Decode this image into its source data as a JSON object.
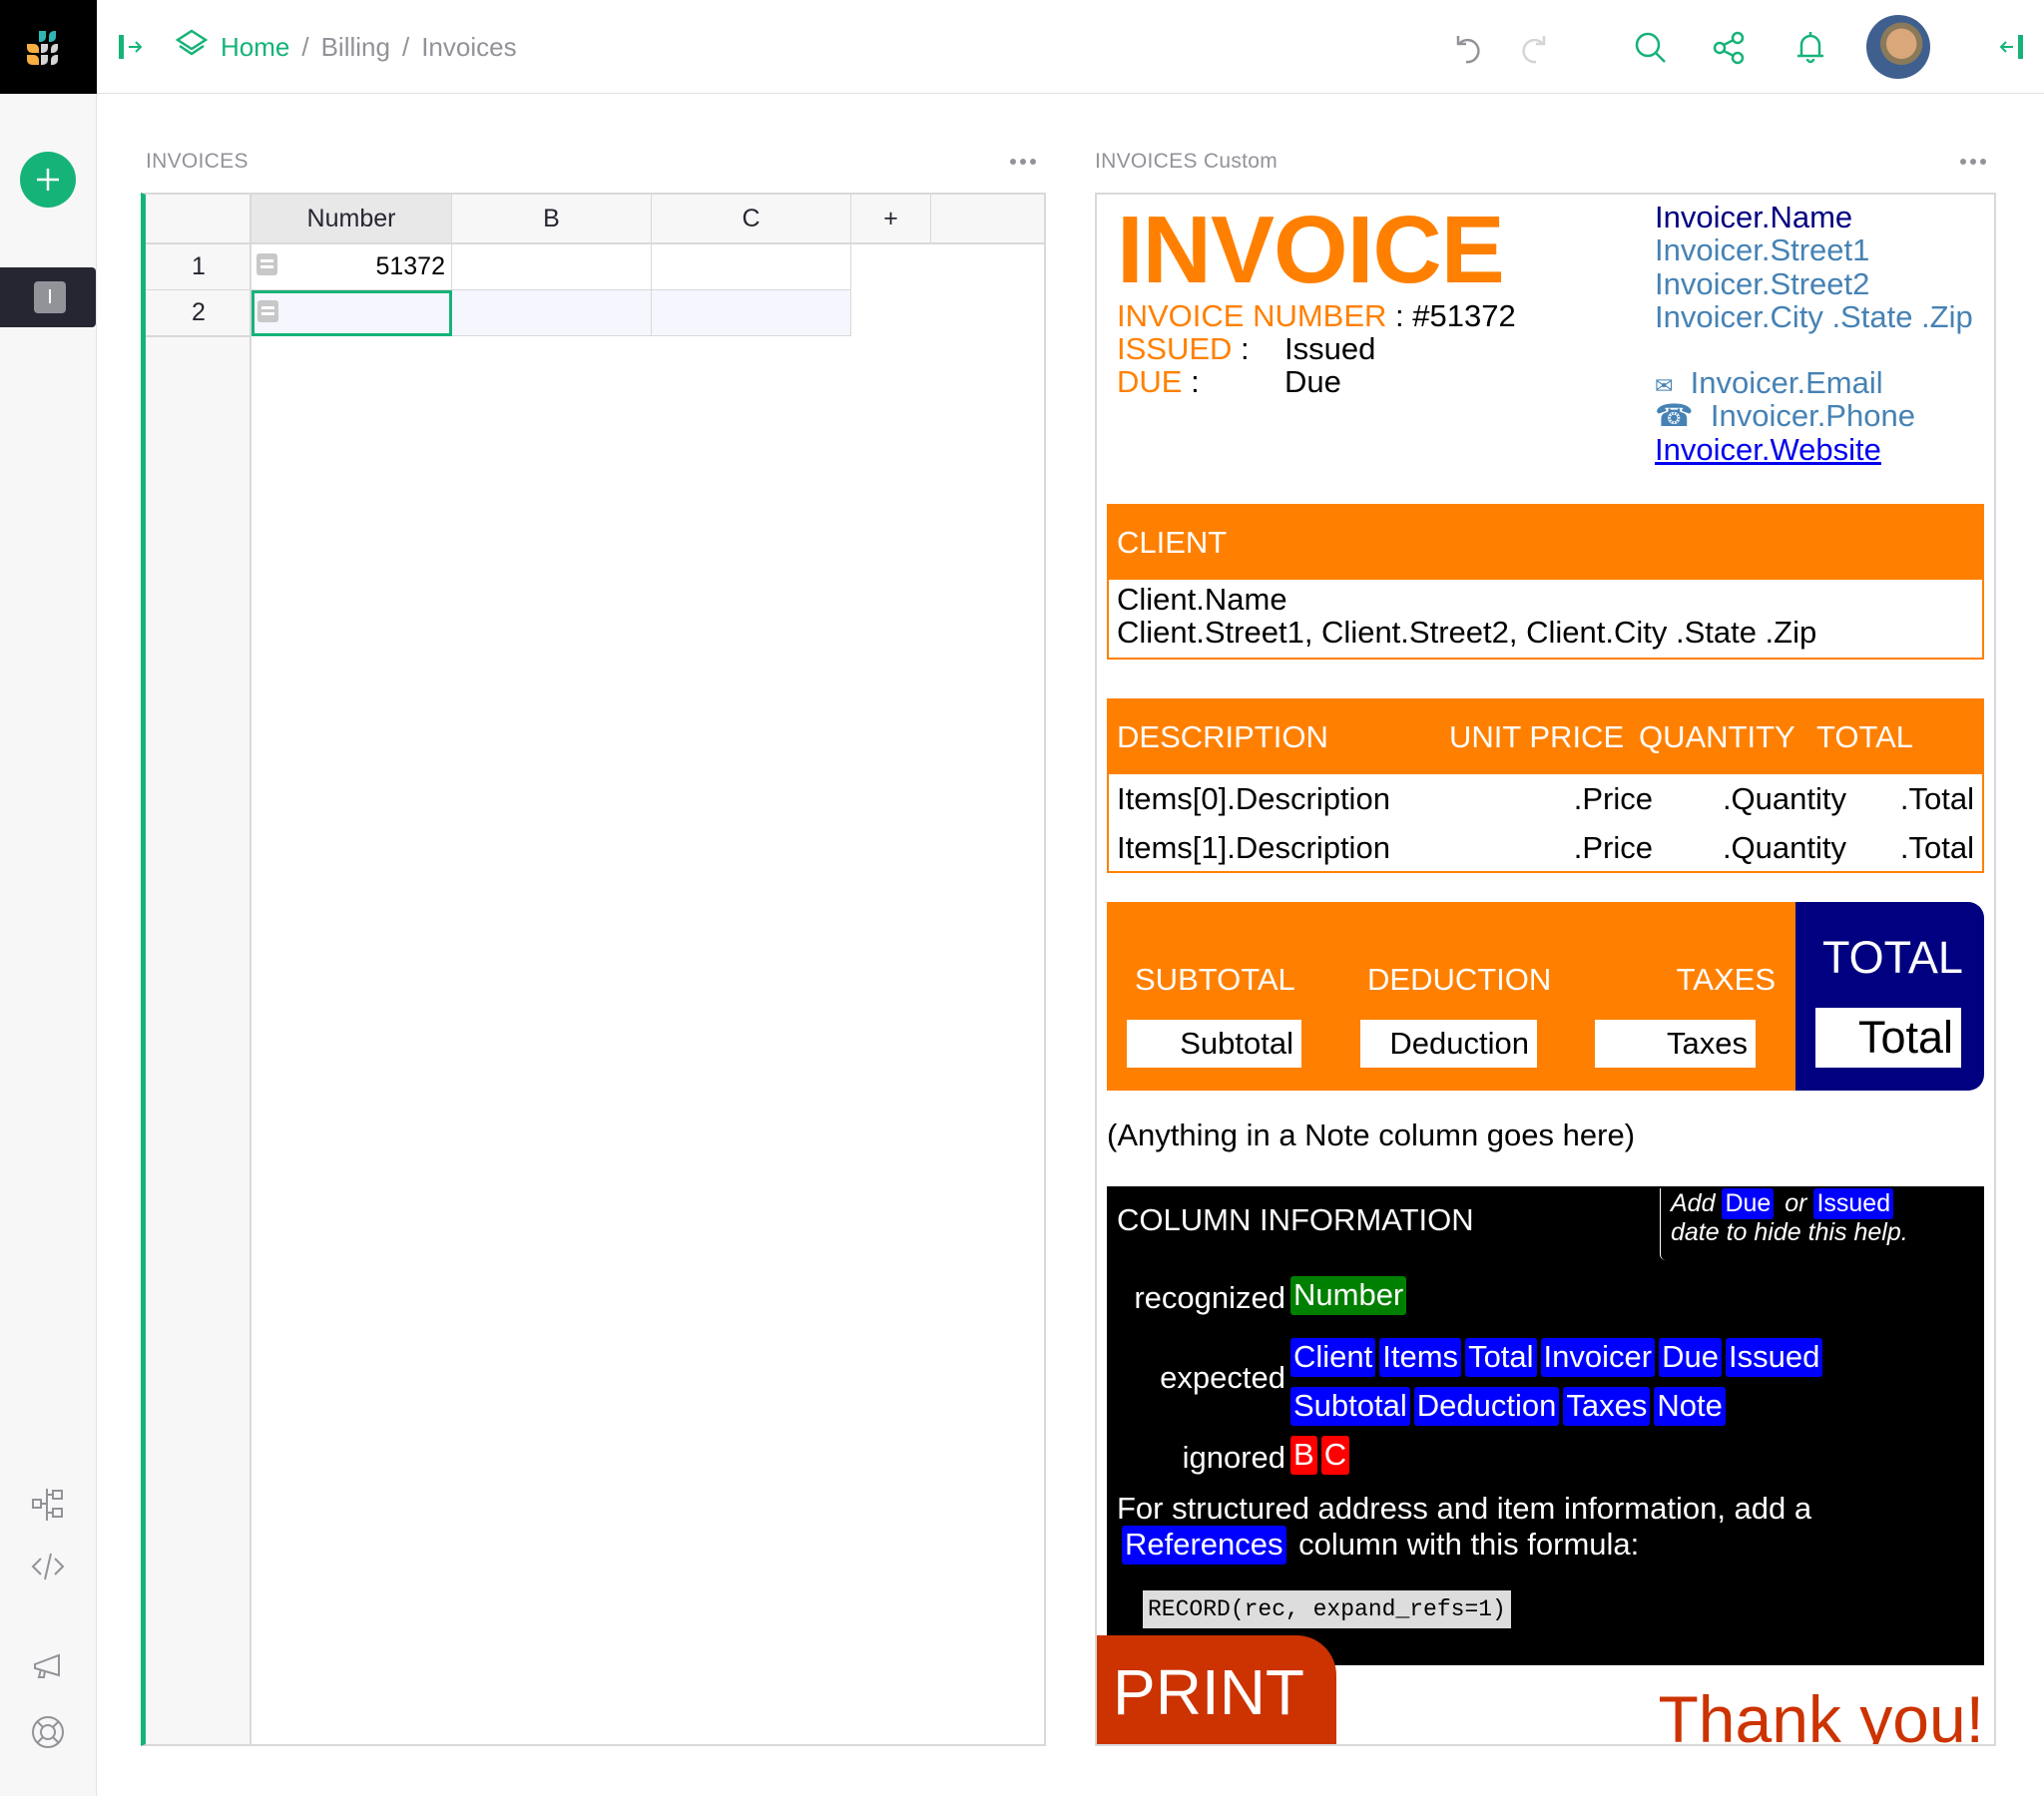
{
  "header": {
    "breadcrumb": {
      "home": "Home",
      "items": [
        "Billing",
        "Invoices"
      ],
      "separator": "/"
    },
    "icons": [
      "logo",
      "panel-toggle-left-icon",
      "layers-icon",
      "undo-icon",
      "redo-icon",
      "search-icon",
      "share-icon",
      "bell-icon",
      "avatar",
      "panel-toggle-right-icon"
    ]
  },
  "sidebar": {
    "add_label": "+",
    "page_initial": "I",
    "bottom_icons": [
      "raw-data-icon",
      "code-view-icon",
      "announcement-icon",
      "help-icon"
    ]
  },
  "grid_section": {
    "title": "INVOICES",
    "columns": [
      "Number",
      "B",
      "C",
      "+"
    ],
    "rows": [
      {
        "num": "1",
        "cells": [
          "51372",
          "",
          ""
        ]
      },
      {
        "num": "2",
        "cells": [
          "",
          "",
          ""
        ]
      }
    ]
  },
  "custom_section": {
    "title": "INVOICES Custom",
    "invoice": {
      "title": "INVOICE",
      "number_label": "INVOICE NUMBER",
      "number_value": ": #51372",
      "issued_label": "ISSUED",
      "issued_sep": ":",
      "issued_value": "Issued",
      "due_label": "DUE",
      "due_sep": ":",
      "due_value": "Due",
      "invoicer": {
        "name": "Invoicer.Name",
        "street1": "Invoicer.Street1",
        "street2": "Invoicer.Street2",
        "city": "Invoicer.City .State .Zip",
        "email_icon": "✉",
        "email": "Invoicer.Email",
        "phone_icon": "☎",
        "phone": "Invoicer.Phone",
        "website": "Invoicer.Website"
      },
      "client": {
        "header": "CLIENT",
        "name": "Client.Name",
        "address": "Client.Street1, Client.Street2, Client.City .State .Zip"
      },
      "items": {
        "headers": [
          "DESCRIPTION",
          "UNIT PRICE",
          "QUANTITY",
          "TOTAL"
        ],
        "rows": [
          [
            "Items[0].Description",
            ".Price",
            ".Quantity",
            ".Total"
          ],
          [
            "Items[1].Description",
            ".Price",
            ".Quantity",
            ".Total"
          ]
        ]
      },
      "totals": {
        "subtotal_label": "SUBTOTAL",
        "subtotal_value": "Subtotal",
        "deduction_label": "DEDUCTION",
        "deduction_value": "Deduction",
        "taxes_label": "TAXES",
        "taxes_value": "Taxes",
        "total_label": "TOTAL",
        "total_value": "Total"
      },
      "note": "(Anything in a Note column goes here)",
      "column_info": {
        "title": "COLUMN INFORMATION",
        "hint_add": "Add",
        "hint_due": "Due",
        "hint_or": "or",
        "hint_issued": "Issued",
        "hint_rest": "date to hide this help.",
        "recognized_label": "recognized",
        "recognized": [
          "Number"
        ],
        "expected_label": "expected",
        "expected_row1": [
          "Client",
          "Items",
          "Total",
          "Invoicer",
          "Due",
          "Issued"
        ],
        "expected_row2": [
          "Subtotal",
          "Deduction",
          "Taxes",
          "Note"
        ],
        "ignored_label": "ignored",
        "ignored": [
          "B",
          "C"
        ],
        "structured_text": "For structured address and item information, add a",
        "references": "References",
        "structured_rest": "column with this formula:",
        "formula": "RECORD(rec, expand_refs=1)"
      },
      "print_label": "PRINT",
      "thanks": "Thank you!"
    }
  },
  "colors": {
    "accent": "#16b378",
    "invoice_orange": "#ff8000",
    "invoice_navy": "#000080",
    "print_red": "#cc3300",
    "pill_blue": "#0000ff",
    "pill_green": "#008000",
    "pill_red": "#ff0000"
  }
}
